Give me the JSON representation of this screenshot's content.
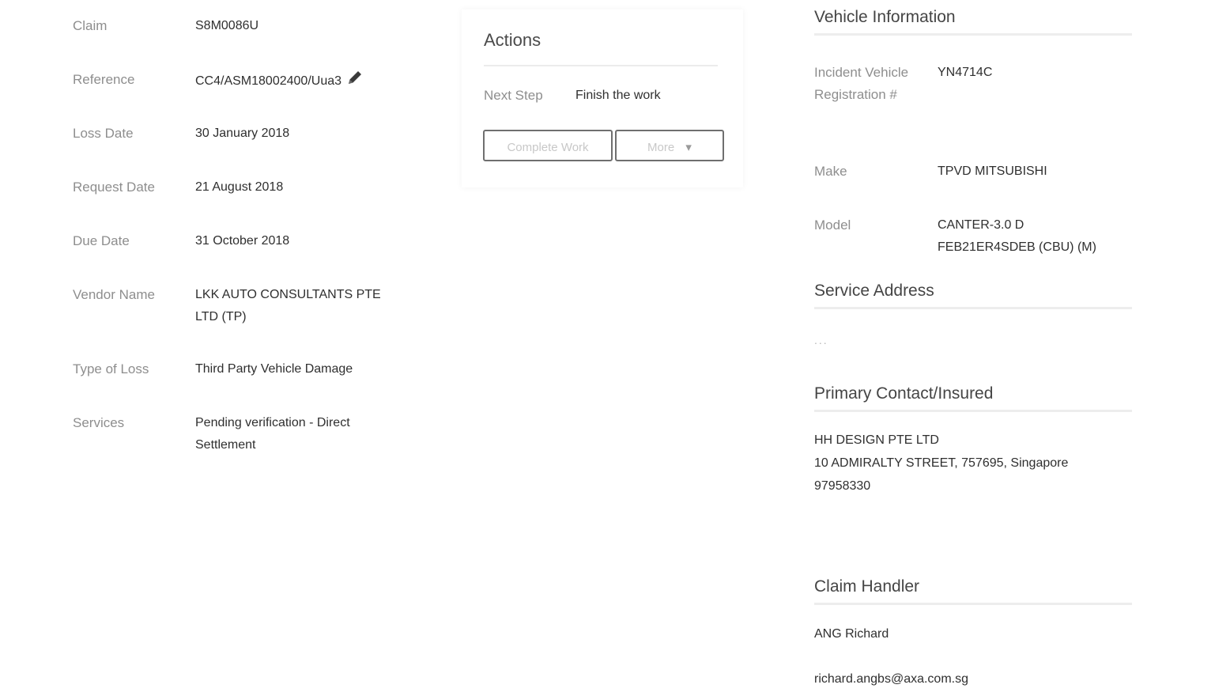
{
  "claim_details": [
    {
      "label": "Claim",
      "value": "S8M0086U"
    },
    {
      "label": "Reference",
      "value": "CC4/ASM18002400/Uua3"
    },
    {
      "label": "Loss Date",
      "value": "30 January 2018"
    },
    {
      "label": "Request Date",
      "value": "21 August 2018"
    },
    {
      "label": "Due Date",
      "value": "31 October 2018"
    },
    {
      "label": "Vendor Name",
      "value": "LKK AUTO CONSULTANTS PTE LTD (TP)"
    },
    {
      "label": "Type of Loss",
      "value": "Third Party Vehicle Damage"
    },
    {
      "label": "Services",
      "value": "Pending verification - Direct Settlement"
    }
  ],
  "actions": {
    "title": "Actions",
    "next_step_label": "Next Step",
    "next_step_value": "Finish the work",
    "complete_button": "Complete Work",
    "more_button": "More",
    "more_caret": "▾"
  },
  "vehicle": {
    "title": "Vehicle Information",
    "fields": [
      {
        "label": "Incident Vehicle Registration #",
        "value": "YN4714C"
      },
      {
        "label": "Make",
        "value": "TPVD MITSUBISHI"
      },
      {
        "label": "Model",
        "value": "CANTER-3.0 D FEB21ER4SDEB (CBU) (M)"
      }
    ]
  },
  "service_address": {
    "title": "Service Address",
    "value": "..."
  },
  "primary_contact": {
    "title": "Primary Contact/Insured",
    "name": "HH DESIGN PTE LTD",
    "address": "10 ADMIRALTY STREET, 757695, Singapore",
    "phone": "97958330"
  },
  "claim_handler": {
    "title": "Claim Handler",
    "name": "ANG Richard",
    "email": "richard.angbs@axa.com.sg"
  },
  "icons": {
    "edit": "pencil-icon"
  }
}
